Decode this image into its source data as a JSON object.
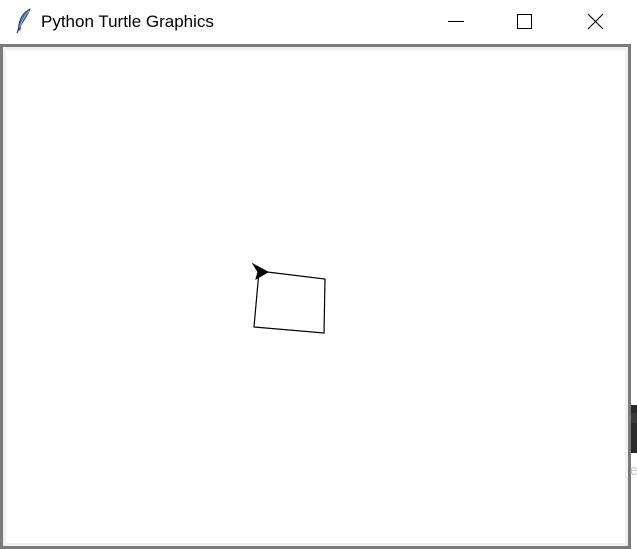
{
  "window": {
    "title": "Python Turtle Graphics",
    "icon": "feather-icon",
    "controls": {
      "minimize_icon": "minimize-icon",
      "maximize_icon": "maximize-icon",
      "close_icon": "close-icon"
    }
  },
  "canvas": {
    "background": "#ffffff",
    "border_color": "#7a7a7a",
    "drawing": {
      "shape": "quadrilateral",
      "stroke_color": "#000000",
      "turtle_cursor": "turtle-arrow-icon",
      "turtle_color": "#000000"
    }
  },
  "background_window": {
    "edge_text": "e"
  }
}
